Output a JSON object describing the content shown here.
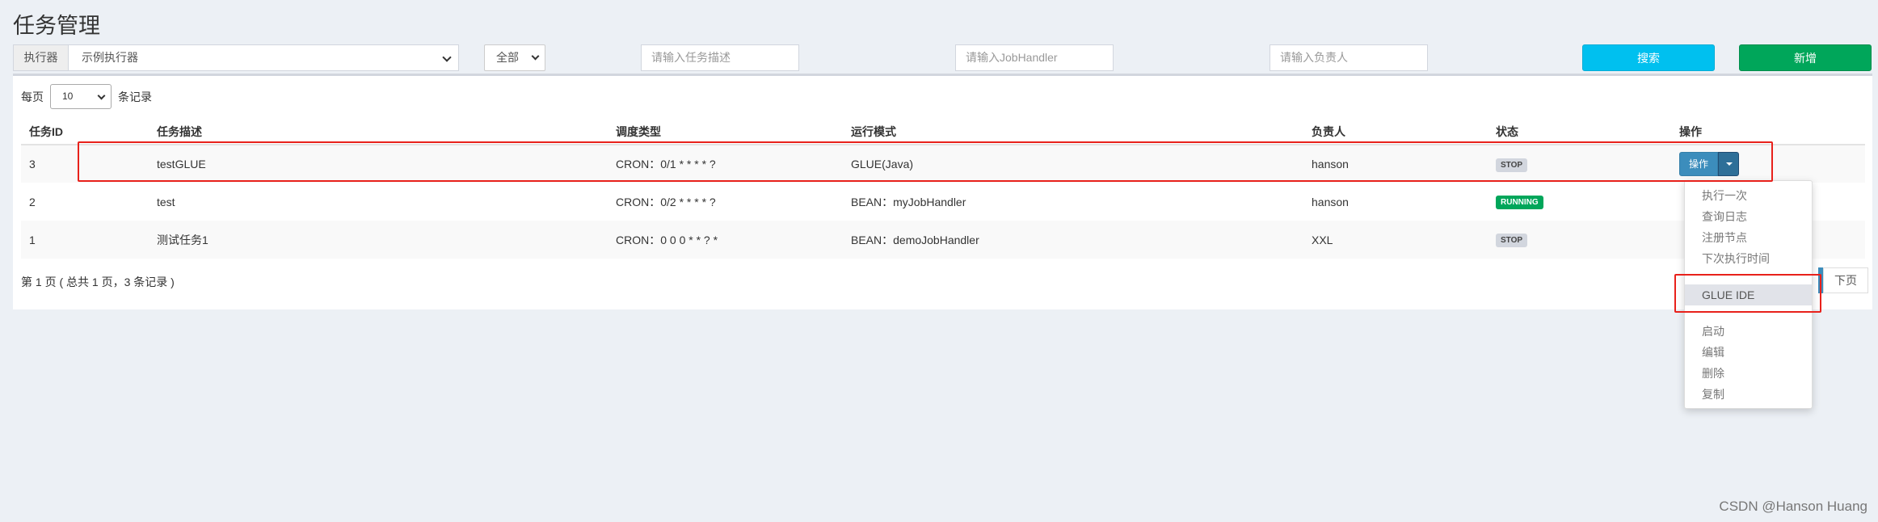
{
  "page": {
    "title": "任务管理"
  },
  "filters": {
    "executor_label": "执行器",
    "executor_value": "示例执行器",
    "status_value": "全部",
    "desc_placeholder": "请输入任务描述",
    "handler_placeholder": "请输入JobHandler",
    "author_placeholder": "请输入负责人",
    "search_label": "搜索",
    "add_label": "新增"
  },
  "page_size": {
    "prefix": "每页",
    "value": "10",
    "suffix": "条记录"
  },
  "table": {
    "headers": [
      "任务ID",
      "任务描述",
      "调度类型",
      "运行模式",
      "负责人",
      "状态",
      "操作"
    ],
    "rows": [
      {
        "id": "3",
        "desc": "testGLUE",
        "schedule": "CRON：0/1 * * * * ?",
        "mode": "GLUE(Java)",
        "author": "hanson",
        "status": "STOP",
        "status_color": "#d2d6de"
      },
      {
        "id": "2",
        "desc": "test",
        "schedule": "CRON：0/2 * * * * ?",
        "mode": "BEAN：myJobHandler",
        "author": "hanson",
        "status": "RUNNING",
        "status_color": "#00a65a"
      },
      {
        "id": "1",
        "desc": "测试任务1",
        "schedule": "CRON：0 0 0 * * ? *",
        "mode": "BEAN：demoJobHandler",
        "author": "XXL",
        "status": "STOP",
        "status_color": "#d2d6de"
      }
    ],
    "op_button": "操作"
  },
  "paging": {
    "info": "第 1 页 ( 总共 1 页，3 条记录 )",
    "next": "下页"
  },
  "dropdown": {
    "items": [
      "执行一次",
      "查询日志",
      "注册节点",
      "下次执行时间",
      "GLUE IDE",
      "启动",
      "编辑",
      "删除",
      "复制"
    ],
    "active": "GLUE IDE"
  },
  "watermark": "CSDN @Hanson Huang",
  "colors": {
    "search": "#00c0ef",
    "add": "#00a65a",
    "op": "#3c8dbc",
    "annotation": "#e8211b"
  }
}
